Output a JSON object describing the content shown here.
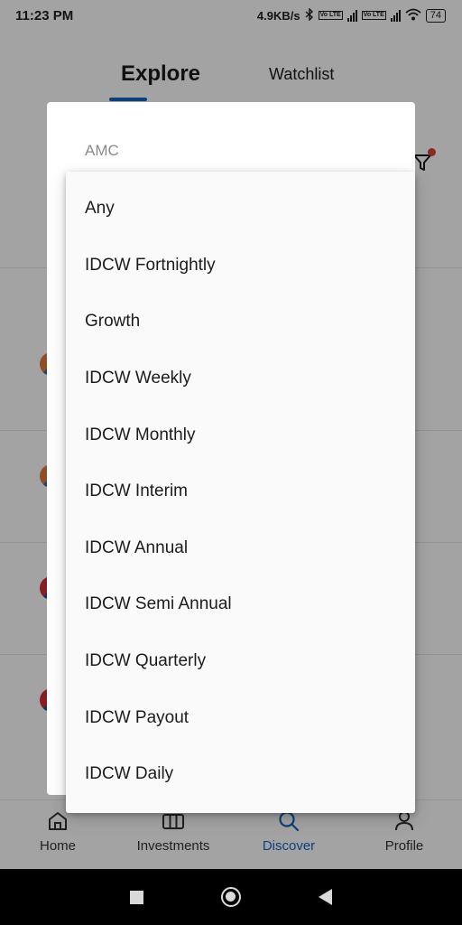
{
  "status_bar": {
    "time": "11:23 PM",
    "net_speed": "4.9KB/s",
    "volte_1": "Vo LTE",
    "volte_2": "Vo LTE",
    "battery": "74"
  },
  "tabs": {
    "explore": "Explore",
    "watchlist": "Watchlist"
  },
  "dialog": {
    "field_label": "AMC"
  },
  "menu": {
    "items": [
      "Any",
      "IDCW Fortnightly",
      "Growth",
      "IDCW Weekly",
      "IDCW Monthly",
      "IDCW Interim",
      "IDCW Annual",
      "IDCW Semi Annual",
      "IDCW Quarterly",
      "IDCW Payout",
      "IDCW Daily"
    ]
  },
  "bottom_nav": {
    "home": "Home",
    "investments": "Investments",
    "discover": "Discover",
    "profile": "Profile"
  },
  "colors": {
    "accent": "#1565c0",
    "filter_dot": "#d64531"
  }
}
